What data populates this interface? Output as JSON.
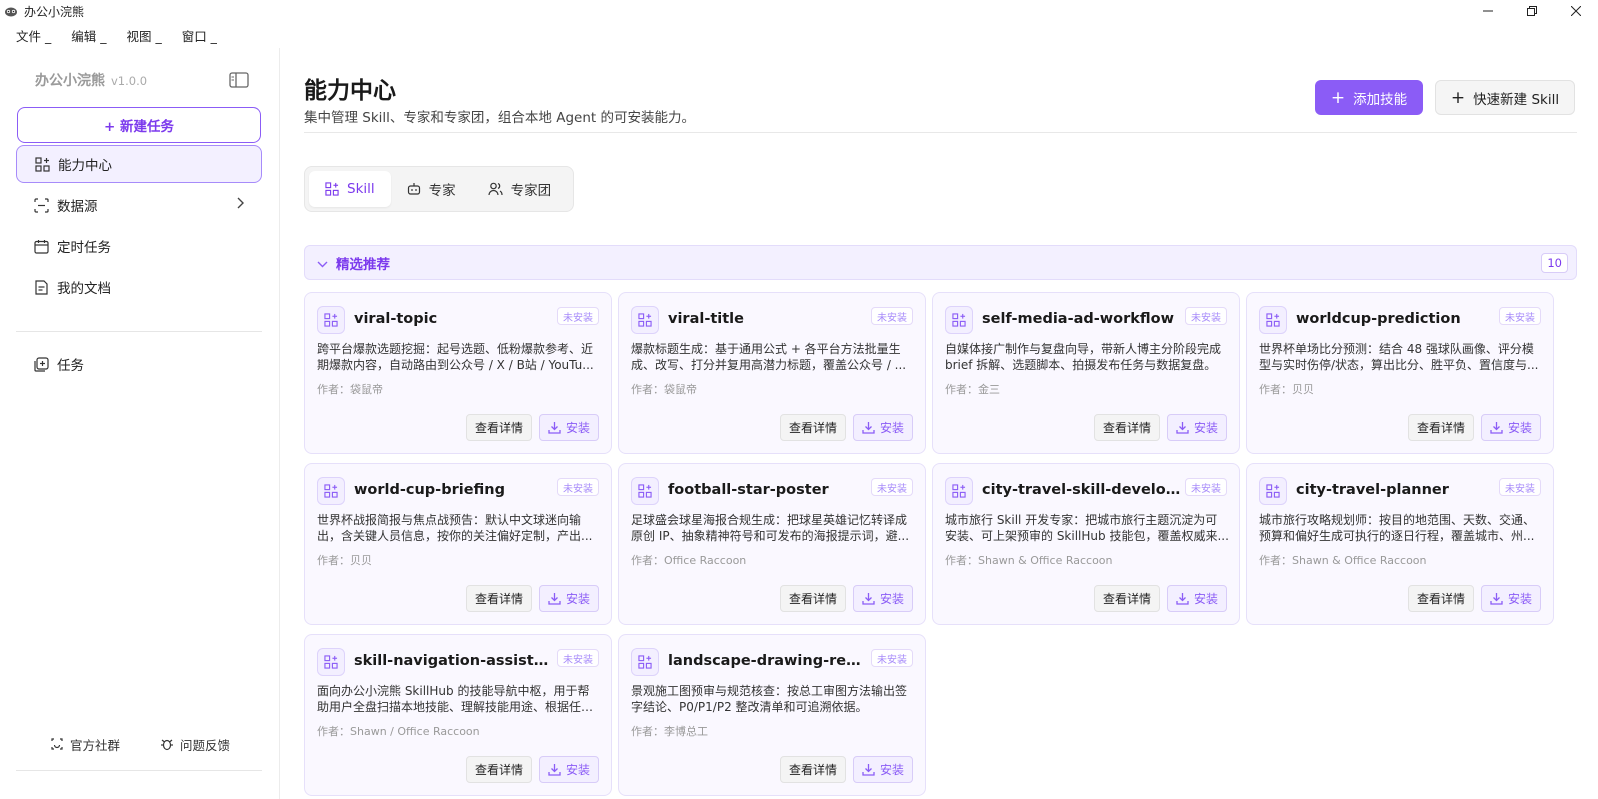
{
  "window": {
    "title": "办公小浣熊",
    "controls": [
      "minimize",
      "restore",
      "close"
    ]
  },
  "menubar": [
    "文件 _",
    "编辑 _",
    "视图 _",
    "窗口 _"
  ],
  "sidebar": {
    "brand": "办公小浣熊",
    "version": "v1.0.0",
    "new_task": "+ 新建任务",
    "items": [
      {
        "label": "能力中心",
        "icon": "grid-plus-icon",
        "active": true
      },
      {
        "label": "数据源",
        "icon": "database-icon",
        "active": false
      },
      {
        "label": "定时任务",
        "icon": "calendar-icon",
        "active": false
      },
      {
        "label": "我的文档",
        "icon": "document-icon",
        "active": false
      },
      {
        "label": "任务",
        "icon": "task-icon",
        "active": false
      }
    ],
    "footer": {
      "community": "官方社群",
      "feedback": "问题反馈"
    }
  },
  "header": {
    "title": "能力中心",
    "subtitle": "集中管理 Skill、专家和专家团，组合本地 Agent 的可安装能力。",
    "add_skill": "添加技能",
    "quick_new": "快速新建 Skill"
  },
  "tabs": [
    {
      "label": "Skill",
      "active": true
    },
    {
      "label": "专家",
      "active": false
    },
    {
      "label": "专家团",
      "active": false
    }
  ],
  "section": {
    "title": "精选推荐",
    "count": "10"
  },
  "card_labels": {
    "detail": "查看详情",
    "install": "安装"
  },
  "skills": [
    {
      "name": "viral-topic",
      "status": "未安装",
      "desc": "跨平台爆款选题挖掘：起号选题、低粉爆款参考、近期爆款内容，自动路由到公众号 / X / B站 / YouTu...",
      "author": "作者：袋鼠帝"
    },
    {
      "name": "viral-title",
      "status": "未安装",
      "desc": "爆款标题生成：基于通用公式 + 各平台方法批量生成、改写、打分并复用高潜力标题，覆盖公众号 / ...",
      "author": "作者：袋鼠帝"
    },
    {
      "name": "self-media-ad-workflow",
      "status": "未安装",
      "desc": "自媒体接广制作与复盘向导，带新人博主分阶段完成 brief 拆解、选题脚本、拍摄发布任务与数据复盘。",
      "author": "作者：金三"
    },
    {
      "name": "worldcup-prediction",
      "status": "未安装",
      "desc": "世界杯单场比分预测：结合 48 强球队画像、评分模型与实时伤停/状态，算出比分、胜平负、置信度与...",
      "author": "作者：贝贝"
    },
    {
      "name": "world-cup-briefing",
      "status": "未安装",
      "desc": "世界杯战报简报与焦点战预告：默认中文球迷向输出，含关键人员信息，按你的关注偏好定制，产出...",
      "author": "作者：贝贝"
    },
    {
      "name": "football-star-poster",
      "status": "未安装",
      "desc": "足球盛会球星海报合规生成：把球星英雄记忆转译成原创 IP、抽象精神符号和可发布的海报提示词，避...",
      "author": "作者：Office Raccoon"
    },
    {
      "name": "city-travel-skill-developer",
      "status": "未安装",
      "desc": "城市旅行 Skill 开发专家：把城市旅行主题沉淀为可安装、可上架预审的 SkillHub 技能包，覆盖权威来...",
      "author": "作者：Shawn & Office Raccoon"
    },
    {
      "name": "city-travel-planner",
      "status": "未安装",
      "desc": "城市旅行攻略规划师：按目的地范围、天数、交通、预算和偏好生成可执行的逐日行程，覆盖城市、州...",
      "author": "作者：Shawn & Office Raccoon"
    },
    {
      "name": "skill-navigation-assistant-sl",
      "status": "未安装",
      "desc": "面向办公小浣熊 SkillHub 的技能导航中枢，用于帮助用户全盘扫描本地技能、理解技能用途、根据任务...",
      "author": "作者：Shawn / Office Raccoon"
    },
    {
      "name": "landscape-drawing-review...",
      "status": "未安装",
      "desc": "景观施工图预审与规范核查：按总工审图方法输出签字结论、P0/P1/P2 整改清单和可追溯依据。",
      "author": "作者：李博总工"
    }
  ],
  "colors": {
    "accent": "#8b5cf6",
    "accent_bg": "#f3f0ff",
    "card_bg": "#faf8ff"
  }
}
